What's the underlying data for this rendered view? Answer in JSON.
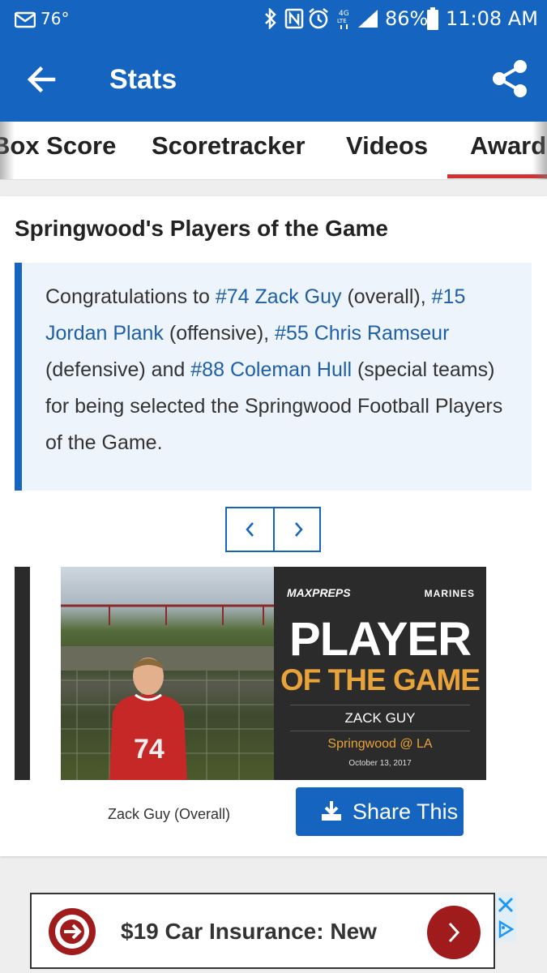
{
  "status_bar": {
    "temperature": "76°",
    "battery": "86%",
    "time": "11:08 AM",
    "icons": [
      "mail-icon",
      "bluetooth-icon",
      "nfc-icon",
      "alarm-icon",
      "4g-lte-icon",
      "signal-icon",
      "battery-icon"
    ]
  },
  "app_bar": {
    "title": "Stats",
    "back_icon": "arrow-left-icon",
    "share_icon": "share-icon"
  },
  "tabs": [
    {
      "label": "Box Score"
    },
    {
      "label": "Scoretracker"
    },
    {
      "label": "Videos"
    },
    {
      "label": "Awards",
      "active": true
    }
  ],
  "awards": {
    "heading": "Springwood's Players of the Game",
    "text": {
      "t1": "Congratulations to ",
      "l1": "#74 Zack Guy",
      "t2": " (overall), ",
      "l2": "#15 Jordan Plank",
      "t3": " (offensive), ",
      "l3": "#55 Chris Ramseur",
      "t4": " (defensive) and ",
      "l4": "#88 Coleman Hull",
      "t5": " (special teams) for being selected the Springwood Football Players of the Game."
    },
    "slide": {
      "brand_left": "MAXPREPS",
      "brand_right": "MARINES",
      "headline": "PLAYER",
      "subhead": "OF THE GAME",
      "player_name": "ZACK GUY",
      "matchup": "Springwood @ LA",
      "date": "October 13, 2017",
      "jersey_number": "74",
      "caption": "Zack Guy (Overall)"
    },
    "share_label": "Share This"
  },
  "ad": {
    "text": "$19 Car Insurance: New",
    "colors": {
      "accent": "#a01c1c"
    }
  },
  "colors": {
    "primary": "#1565c0",
    "tab_indicator": "#d32f2f",
    "link": "#1e5fa8",
    "promo_gold": "#e8a33a"
  }
}
